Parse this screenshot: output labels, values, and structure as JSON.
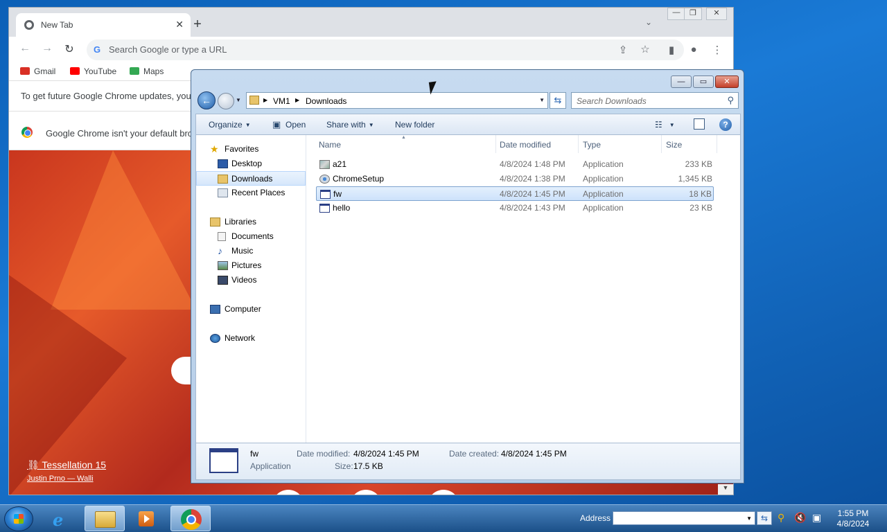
{
  "chrome": {
    "tab_title": "New Tab",
    "tab_close": "✕",
    "new_tab": "+",
    "tab_search": "⌄",
    "window_controls": {
      "minimize": "—",
      "restore": "❐",
      "close": "✕"
    },
    "nav": {
      "back": "←",
      "forward": "→",
      "reload": "↻"
    },
    "omnibox_g": "G",
    "omnibox_placeholder": "Search Google or type a URL",
    "toolbar_icons": {
      "share": "⇪",
      "star": "☆",
      "sidepanel": "▮",
      "profile": "●",
      "menu": "⋮"
    },
    "bookmarks": [
      {
        "label": "Gmail",
        "color": "#d93025"
      },
      {
        "label": "YouTube",
        "color": "#ff0000"
      },
      {
        "label": "Maps",
        "color": "#34a853"
      }
    ],
    "update_notice": "To get future Google Chrome updates, you",
    "default_notice": "Google Chrome isn't your default bro",
    "attribution_title": "Tessellation 15",
    "attribution_author": "Justin Prno — Walli",
    "attribution_link_icon": "⛓",
    "scroll_down": "▼"
  },
  "explorer": {
    "caption": {
      "minimize": "—",
      "maximize": "▭",
      "close": "✕"
    },
    "back": "←",
    "breadcrumb": [
      "VM1",
      "Downloads"
    ],
    "refresh": "⇆",
    "search_placeholder": "Search Downloads",
    "search_icon": "⚲",
    "commands": {
      "organize": "Organize",
      "open": "Open",
      "share_with": "Share with",
      "new_folder": "New folder"
    },
    "view_icon": "☷",
    "help": "?",
    "nav": {
      "favorites": "Favorites",
      "desktop": "Desktop",
      "downloads": "Downloads",
      "recent_places": "Recent Places",
      "libraries": "Libraries",
      "documents": "Documents",
      "music": "Music",
      "pictures": "Pictures",
      "videos": "Videos",
      "computer": "Computer",
      "network": "Network"
    },
    "columns": {
      "name": "Name",
      "date_modified": "Date modified",
      "type": "Type",
      "size": "Size"
    },
    "files": [
      {
        "name": "a21",
        "date": "4/8/2024 1:48 PM",
        "type": "Application",
        "size": "233 KB",
        "icon": "image-app-icon"
      },
      {
        "name": "ChromeSetup",
        "date": "4/8/2024 1:38 PM",
        "type": "Application",
        "size": "1,345 KB",
        "icon": "setup-icon"
      },
      {
        "name": "fw",
        "date": "4/8/2024 1:45 PM",
        "type": "Application",
        "size": "18 KB",
        "icon": "window-app-icon"
      },
      {
        "name": "hello",
        "date": "4/8/2024 1:43 PM",
        "type": "Application",
        "size": "23 KB",
        "icon": "window-app-icon"
      }
    ],
    "details": {
      "name": "fw",
      "type": "Application",
      "date_modified_label": "Date modified:",
      "date_modified": "4/8/2024 1:45 PM",
      "date_created_label": "Date created:",
      "date_created": "4/8/2024 1:45 PM",
      "size_label": "Size:",
      "size": "17.5 KB"
    }
  },
  "taskbar": {
    "address_label": "Address",
    "address_dropdown": "▼",
    "address_go": "⇆",
    "tray": {
      "search": "⚲",
      "volume": "🔇",
      "network": "▣"
    },
    "time": "1:55 PM",
    "date": "4/8/2024"
  }
}
